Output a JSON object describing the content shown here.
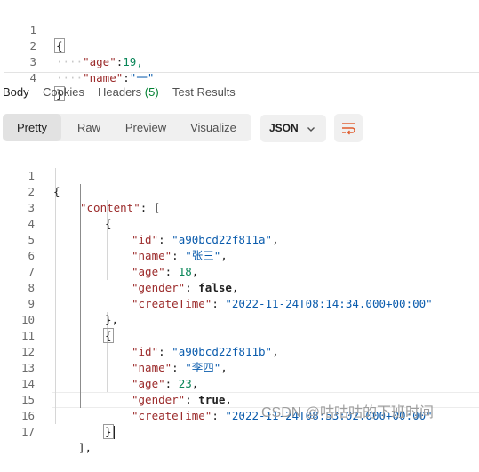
{
  "request_body": {
    "lines": [
      {
        "n": "1",
        "dots": "",
        "key": "",
        "sep": "",
        "val": "",
        "text": "{"
      },
      {
        "n": "2",
        "dots": "····",
        "key": "\"age\"",
        "sep": ":",
        "val": "19,",
        "text": ""
      },
      {
        "n": "3",
        "dots": "····",
        "key": "\"name\"",
        "sep": ":",
        "val": "\"一\"",
        "text": ""
      },
      {
        "n": "4",
        "dots": "",
        "key": "",
        "sep": "",
        "val": "",
        "text": "}"
      }
    ]
  },
  "tabs": {
    "body": "Body",
    "cookies": "Cookies",
    "headers": "Headers",
    "headers_count": "(5)",
    "test_results": "Test Results"
  },
  "toolbar": {
    "pretty": "Pretty",
    "raw": "Raw",
    "preview": "Preview",
    "visualize": "Visualize",
    "format": "JSON",
    "wrap_icon": "wrap-lines-icon",
    "accent": "#e05a2b"
  },
  "response": {
    "line_numbers": [
      "1",
      "2",
      "3",
      "4",
      "5",
      "6",
      "7",
      "8",
      "9",
      "10",
      "11",
      "12",
      "13",
      "14",
      "15",
      "16",
      "17"
    ],
    "l1": "{",
    "content_key": "\"content\"",
    "content_open": ": [",
    "obj1_open": "{",
    "obj1_close": "},",
    "obj2_open": "{",
    "obj2_close": "}",
    "array_close": "],",
    "items": [
      {
        "id_key": "\"id\"",
        "id_val": "\"a90bcd22f811a\"",
        "name_key": "\"name\"",
        "name_val": "\"张三\"",
        "age_key": "\"age\"",
        "age_val": "18",
        "gender_key": "\"gender\"",
        "gender_val": "false",
        "time_key": "\"createTime\"",
        "time_val": "\"2022-11-24T08:14:34.000+00:00\""
      },
      {
        "id_key": "\"id\"",
        "id_val": "\"a90bcd22f811b\"",
        "name_key": "\"name\"",
        "name_val": "\"李四\"",
        "age_key": "\"age\"",
        "age_val": "23",
        "gender_key": "\"gender\"",
        "gender_val": "true",
        "time_key": "\"createTime\"",
        "time_val": "\"2022-11-24T08:53:02.000+00:00\""
      }
    ]
  },
  "watermark": "CSDN @咕咕咕的下班时间"
}
